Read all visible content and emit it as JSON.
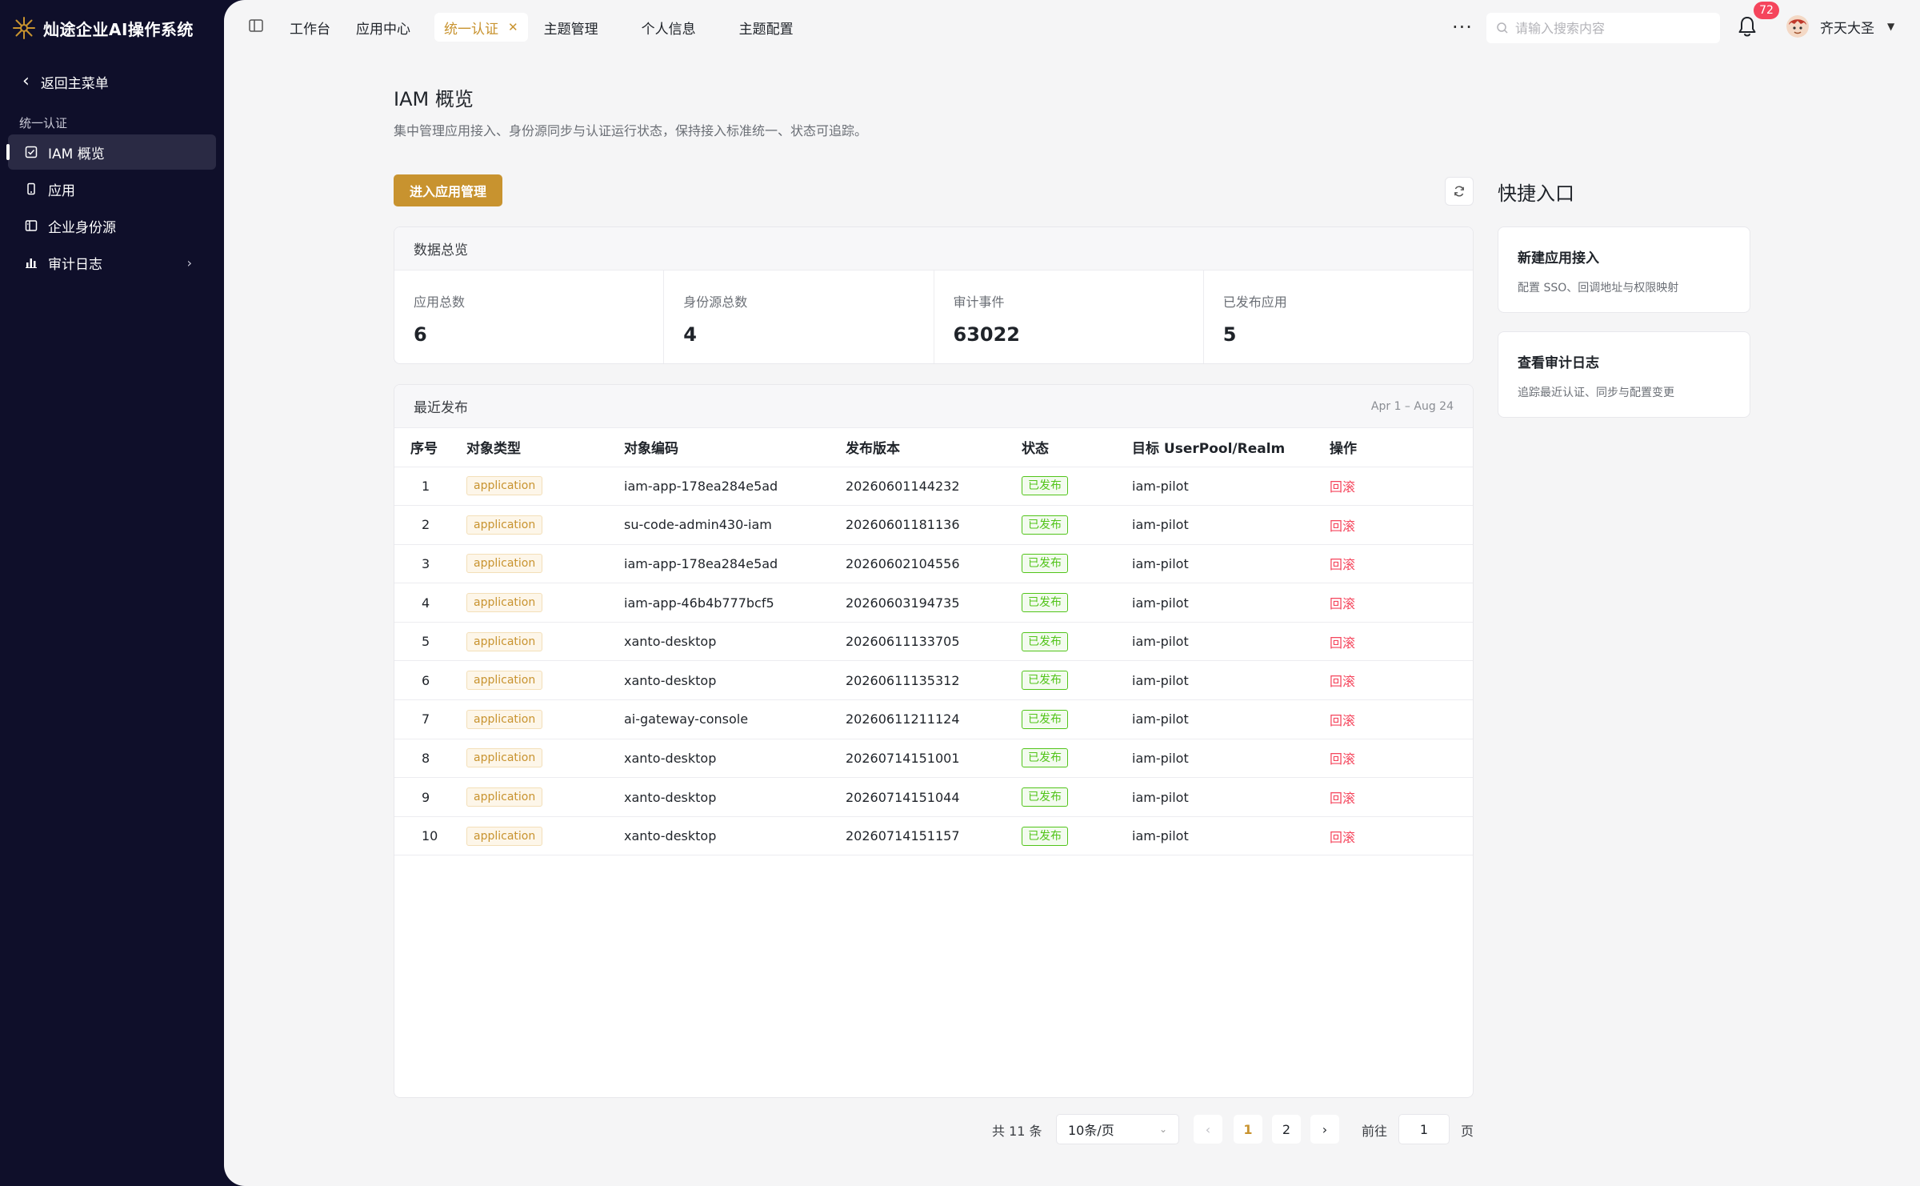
{
  "app": {
    "title": "灿途企业AI操作系统"
  },
  "sidebar": {
    "back_label": "返回主菜单",
    "group_label": "统一认证",
    "items": [
      {
        "label": "IAM 概览",
        "icon": "checkbox-icon",
        "active": true
      },
      {
        "label": "应用",
        "icon": "phone-icon"
      },
      {
        "label": "企业身份源",
        "icon": "id-card-icon"
      },
      {
        "label": "审计日志",
        "icon": "bar-chart-icon",
        "has_children": true
      }
    ]
  },
  "topbar": {
    "tabs": [
      {
        "label": "工作台"
      },
      {
        "label": "应用中心"
      },
      {
        "label": "统一认证",
        "active": true,
        "closable": true
      },
      {
        "label": "主题管理"
      },
      {
        "label": "个人信息"
      },
      {
        "label": "主题配置"
      }
    ],
    "search_placeholder": "请输入搜索内容",
    "notification_count": "72",
    "user_name": "齐天大圣"
  },
  "page": {
    "title": "IAM 概览",
    "description": "集中管理应用接入、身份源同步与认证运行状态，保持接入标准统一、状态可追踪。",
    "primary_button": "进入应用管理"
  },
  "overview": {
    "title": "数据总览",
    "stats": [
      {
        "label": "应用总数",
        "value": "6"
      },
      {
        "label": "身份源总数",
        "value": "4"
      },
      {
        "label": "审计事件",
        "value": "63022"
      },
      {
        "label": "已发布应用",
        "value": "5"
      }
    ]
  },
  "recent": {
    "title": "最近发布",
    "range": "Apr 1 – Aug 24",
    "columns": [
      "序号",
      "对象类型",
      "对象编码",
      "发布版本",
      "状态",
      "目标 UserPool/Realm",
      "操作"
    ],
    "rows": [
      {
        "idx": "1",
        "type": "application",
        "code": "iam-app-178ea284e5ad",
        "version": "20260601144232",
        "status": "已发布",
        "target": "iam-pilot",
        "action": "回滚"
      },
      {
        "idx": "2",
        "type": "application",
        "code": "su-code-admin430-iam",
        "version": "20260601181136",
        "status": "已发布",
        "target": "iam-pilot",
        "action": "回滚"
      },
      {
        "idx": "3",
        "type": "application",
        "code": "iam-app-178ea284e5ad",
        "version": "20260602104556",
        "status": "已发布",
        "target": "iam-pilot",
        "action": "回滚"
      },
      {
        "idx": "4",
        "type": "application",
        "code": "iam-app-46b4b777bcf5",
        "version": "20260603194735",
        "status": "已发布",
        "target": "iam-pilot",
        "action": "回滚"
      },
      {
        "idx": "5",
        "type": "application",
        "code": "xanto-desktop",
        "version": "20260611133705",
        "status": "已发布",
        "target": "iam-pilot",
        "action": "回滚"
      },
      {
        "idx": "6",
        "type": "application",
        "code": "xanto-desktop",
        "version": "20260611135312",
        "status": "已发布",
        "target": "iam-pilot",
        "action": "回滚"
      },
      {
        "idx": "7",
        "type": "application",
        "code": "ai-gateway-console",
        "version": "20260611211124",
        "status": "已发布",
        "target": "iam-pilot",
        "action": "回滚"
      },
      {
        "idx": "8",
        "type": "application",
        "code": "xanto-desktop",
        "version": "20260714151001",
        "status": "已发布",
        "target": "iam-pilot",
        "action": "回滚"
      },
      {
        "idx": "9",
        "type": "application",
        "code": "xanto-desktop",
        "version": "20260714151044",
        "status": "已发布",
        "target": "iam-pilot",
        "action": "回滚"
      },
      {
        "idx": "10",
        "type": "application",
        "code": "xanto-desktop",
        "version": "20260714151157",
        "status": "已发布",
        "target": "iam-pilot",
        "action": "回滚"
      }
    ]
  },
  "pagination": {
    "total": "共 11 条",
    "page_size": "10条/页",
    "pages": [
      "1",
      "2"
    ],
    "current": "1",
    "goto_label": "前往",
    "goto_value": "1",
    "goto_unit": "页"
  },
  "quick": {
    "title": "快捷入口",
    "cards": [
      {
        "title": "新建应用接入",
        "desc": "配置 SSO、回调地址与权限映射"
      },
      {
        "title": "查看审计日志",
        "desc": "追踪最近认证、同步与配置变更"
      }
    ]
  },
  "colors": {
    "accent": "#c8932f",
    "sidebar_bg": "#0f0f2a",
    "success": "#52c41a",
    "danger": "#f5455c"
  }
}
